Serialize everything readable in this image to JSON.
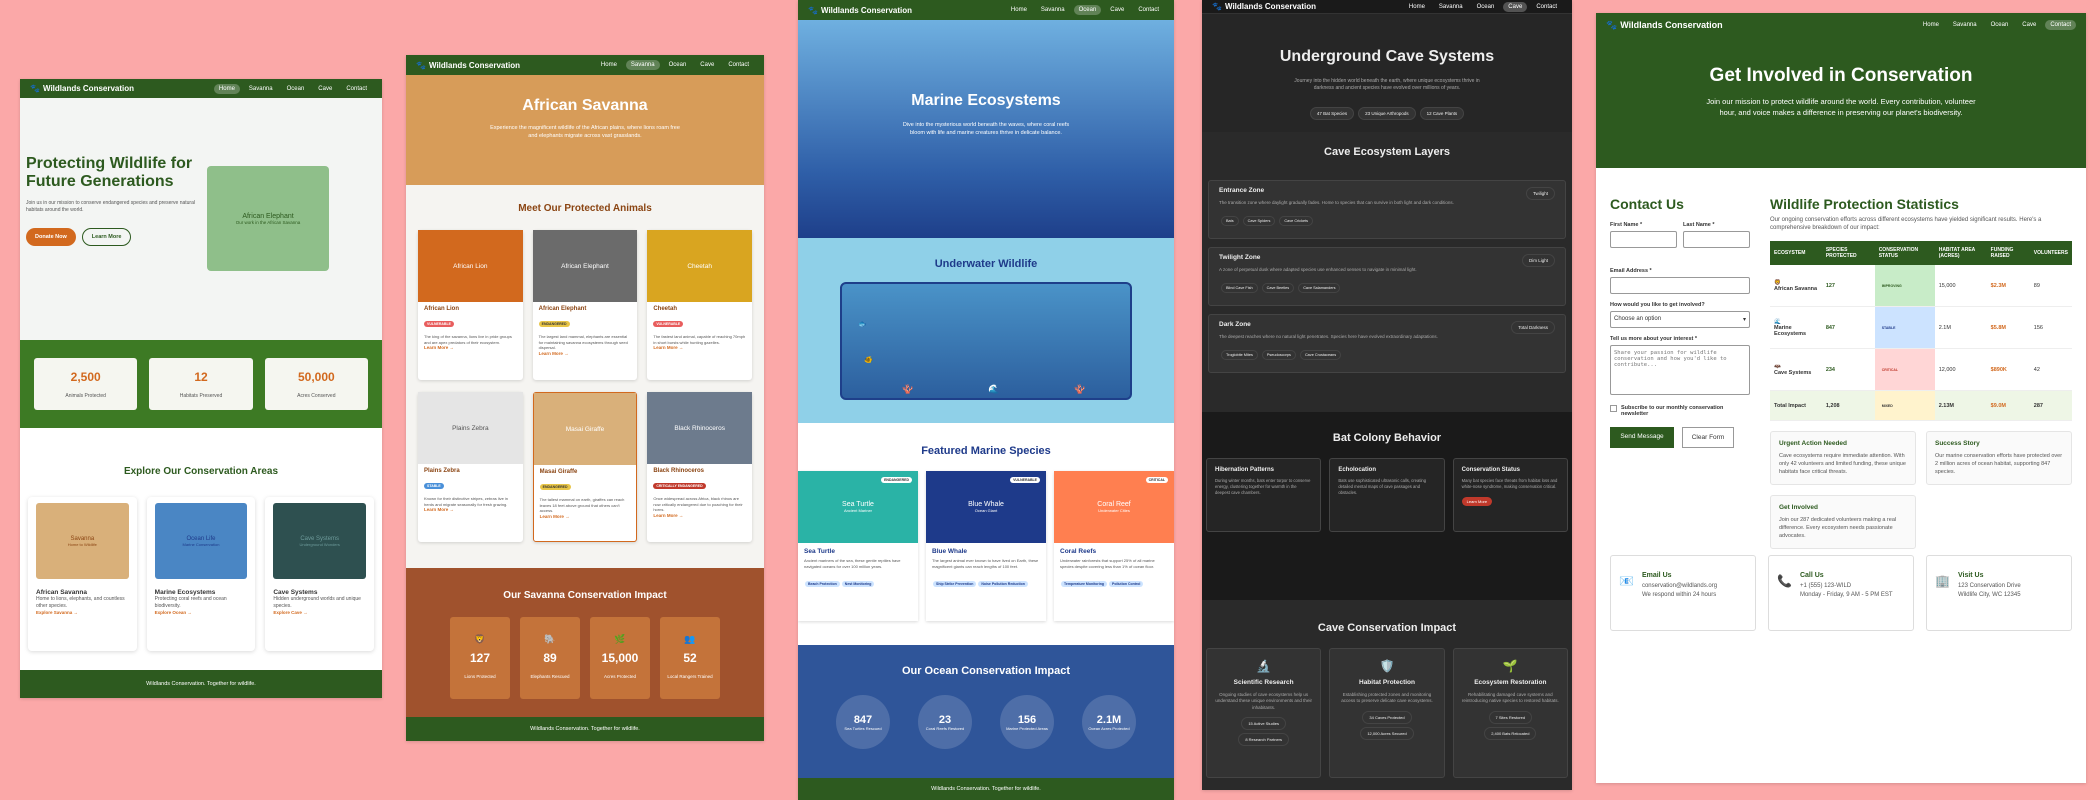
{
  "brand": "Wildlands Conservation",
  "brand_icon": "paw-icon",
  "nav": [
    "Home",
    "Savanna",
    "Ocean",
    "Cave",
    "Contact"
  ],
  "footer": "Wildlands Conservation. Together for wildlife.",
  "home": {
    "title": "Protecting Wildlife for Future Generations",
    "text": "Join us in our mission to conserve endangered species and preserve natural habitats around the world.",
    "donate": "Donate Now",
    "learn": "Learn More",
    "hero_img": "African Elephant",
    "hero_img_sub": "Our work in the African Savanna",
    "stats": [
      {
        "value": "2,500",
        "label": "Animals Protected"
      },
      {
        "value": "12",
        "label": "Habitats Preserved"
      },
      {
        "value": "50,000",
        "label": "Acres Conserved"
      }
    ],
    "explore_title": "Explore Our Conservation Areas",
    "areas": [
      {
        "img": "Savanna",
        "img_sub": "Home to Wildlife",
        "title": "African Savanna",
        "text": "Home to lions, elephants, and countless other species.",
        "link": "Explore Savanna →",
        "color": "#d9b07a"
      },
      {
        "img": "Ocean Life",
        "img_sub": "Marine Conservation",
        "title": "Marine Ecosystems",
        "text": "Protecting coral reefs and ocean biodiversity.",
        "link": "Explore Ocean →",
        "color": "#4a86c4"
      },
      {
        "img": "Cave Systems",
        "img_sub": "Underground Wonders",
        "title": "Cave Systems",
        "text": "Hidden underground worlds and unique species.",
        "link": "Explore Cave →",
        "color": "#2e5050"
      }
    ]
  },
  "savanna": {
    "title": "African Savanna",
    "text": "Experience the magnificent wildlife of the African plains, where lions roam free and elephants migrate across vast grasslands.",
    "animals_title": "Meet Our Protected Animals",
    "animals": [
      {
        "name": "African Lion",
        "status": "VULNERABLE",
        "text": "The king of the savanna, lions live in pride groups and are apex predators of their ecosystem.",
        "color": "#d2691e",
        "tag": "#e85d5d"
      },
      {
        "name": "African Elephant",
        "status": "ENDANGERED",
        "text": "The largest land mammal, elephants are essential for maintaining savanna ecosystems through seed dispersal.",
        "color": "#6b6b6b",
        "tag": "#e8c547"
      },
      {
        "name": "Cheetah",
        "status": "VULNERABLE",
        "text": "The fastest land animal, capable of reaching 70mph in short bursts while hunting gazelles.",
        "color": "#d9a520",
        "tag": "#e85d5d"
      },
      {
        "name": "Plains Zebra",
        "status": "STABLE",
        "text": "Known for their distinctive stripes, zebras live in herds and migrate seasonally for fresh grazing.",
        "color": "#e5e5e5",
        "tag": "#4a90d9"
      },
      {
        "name": "Masai Giraffe",
        "status": "ENDANGERED",
        "text": "The tallest mammal on earth, giraffes can reach leaves 18 feet above ground that others can't access.",
        "color": "#d9b07a",
        "tag": "#e8c547"
      },
      {
        "name": "Black Rhinoceros",
        "status": "CRITICALLY ENDANGERED",
        "text": "Once widespread across Africa, black rhinos are now critically endangered due to poaching for their horns.",
        "color": "#6d7b8d",
        "tag": "#c0392b"
      }
    ],
    "learn": "Learn More →",
    "impact_title": "Our Savanna Conservation Impact",
    "impact": [
      {
        "icon": "lion-icon",
        "value": "127",
        "label": "Lions Protected"
      },
      {
        "icon": "elephant-icon",
        "value": "89",
        "label": "Elephants Rescued"
      },
      {
        "icon": "plant-icon",
        "value": "15,000",
        "label": "Acres Protected"
      },
      {
        "icon": "people-icon",
        "value": "52",
        "label": "Local Rangers Trained"
      }
    ]
  },
  "ocean": {
    "title": "Marine Ecosystems",
    "text": "Dive into the mysterious world beneath the waves, where coral reefs bloom with life and marine creatures thrive in delicate balance.",
    "wild_title": "Underwater Wildlife",
    "species_title": "Featured Marine Species",
    "species": [
      {
        "name": "Sea Turtle",
        "sub": "Ancient Mariner",
        "status": "ENDANGERED",
        "title": "Sea Turtle",
        "text": "Ancient mariners of the sea, these gentle reptiles have navigated oceans for over 100 million years.",
        "tags": [
          "Beach Protection",
          "Nest Monitoring"
        ],
        "color": "#2ab3a6"
      },
      {
        "name": "Blue Whale",
        "sub": "Ocean Giant",
        "status": "VULNERABLE",
        "title": "Blue Whale",
        "text": "The largest animal ever known to have lived on Earth, these magnificent giants can reach lengths of 100 feet.",
        "tags": [
          "Ship Strike Prevention",
          "Noise Pollution Reduction"
        ],
        "color": "#1e3a8a"
      },
      {
        "name": "Coral Reef",
        "sub": "Underwater Cities",
        "status": "CRITICAL",
        "title": "Coral Reefs",
        "text": "Underwater rainforests that support 25% of all marine species despite covering less than 1% of ocean floor.",
        "tags": [
          "Temperature Monitoring",
          "Pollution Control"
        ],
        "color": "#ff7f50"
      }
    ],
    "impact_title": "Our Ocean Conservation Impact",
    "impact": [
      {
        "value": "847",
        "label": "Sea Turtles Rescued"
      },
      {
        "value": "23",
        "label": "Coral Reefs Restored"
      },
      {
        "value": "156",
        "label": "Marine Protected Areas"
      },
      {
        "value": "2.1M",
        "label": "Ocean Acres Protected"
      }
    ]
  },
  "cave": {
    "title": "Underground Cave Systems",
    "text": "Journey into the hidden world beneath the earth, where unique ecosystems thrive in darkness and ancient species have evolved over millions of years.",
    "chips": [
      "47 Bat Species",
      "23 Unique Arthropods",
      "12 Cave Plants"
    ],
    "layers_title": "Cave Ecosystem Layers",
    "layers": [
      {
        "title": "Entrance Zone",
        "badge": "Twilight",
        "text": "The transition zone where daylight gradually fades. Home to species that can survive in both light and dark conditions.",
        "chips": [
          "Bats",
          "Cave Spiders",
          "Cave Crickets"
        ]
      },
      {
        "title": "Twilight Zone",
        "badge": "Dim Light",
        "text": "A zone of perpetual dusk where adapted species use enhanced senses to navigate in minimal light.",
        "chips": [
          "Blind Cave Fish",
          "Cave Beetles",
          "Cave Salamanders"
        ]
      },
      {
        "title": "Dark Zone",
        "badge": "Total Darkness",
        "text": "The deepest reaches where no natural light penetrates. Species here have evolved extraordinary adaptations.",
        "chips": [
          "Troglobite Mites",
          "Pseudoscorps",
          "Cave Crustaceans"
        ]
      }
    ],
    "bats_title": "Bat Colony Behavior",
    "bats": [
      {
        "title": "Hibernation Patterns",
        "text": "During winter months, bats enter torpor to conserve energy, clustering together for warmth in the deepest cave chambers."
      },
      {
        "title": "Echolocation",
        "text": "Bats use sophisticated ultrasonic calls, creating detailed mental maps of cave passages and obstacles."
      },
      {
        "title": "Conservation Status",
        "text": "Many bat species face threats from habitat loss and white-nose syndrome, making conservation critical.",
        "btn": "Learn More"
      }
    ],
    "impact_title": "Cave Conservation Impact",
    "impact": [
      {
        "icon": "microscope-icon",
        "title": "Scientific Research",
        "text": "Ongoing studies of cave ecosystems help us understand these unique environments and their inhabitants.",
        "pills": [
          "15 Active Studies",
          "8 Research Partners"
        ]
      },
      {
        "icon": "shield-icon",
        "title": "Habitat Protection",
        "text": "Establishing protected zones and monitoring access to preserve delicate cave ecosystems.",
        "pills": [
          "34 Caves Protected",
          "12,000 Acres Secured"
        ]
      },
      {
        "icon": "sprout-icon",
        "title": "Ecosystem Restoration",
        "text": "Rehabilitating damaged cave systems and reintroducing native species to restored habitats.",
        "pills": [
          "7 Sites Restored",
          "2,400 Bats Relocated"
        ]
      }
    ]
  },
  "contact": {
    "title": "Get Involved in Conservation",
    "text": "Join our mission to protect wildlife around the world. Every contribution, volunteer hour, and voice makes a difference in preserving our planet's biodiversity.",
    "form_title": "Contact Us",
    "first": "First Name *",
    "last": "Last Name *",
    "email": "Email Address *",
    "involve": "How would you like to get involved?",
    "involve_value": "Choose an option",
    "interest": "Tell us more about your interest *",
    "interest_ph": "Share your passion for wildlife conservation and how you'd like to contribute...",
    "newsletter": "Subscribe to our monthly conservation newsletter",
    "send": "Send Message",
    "clear": "Clear Form",
    "stats_title": "Wildlife Protection Statistics",
    "stats_text": "Our ongoing conservation efforts across different ecosystems have yielded significant results. Here's a comprehensive breakdown of our impact:",
    "headers": [
      "ECOSYSTEM",
      "SPECIES PROTECTED",
      "CONSERVATION STATUS",
      "HABITAT AREA (ACRES)",
      "FUNDING RAISED",
      "VOLUNTEERS"
    ],
    "rows": [
      {
        "eco": "African Savanna",
        "icon": "lion-icon",
        "species": "127",
        "status": "IMPROVING",
        "status_bg": "#c8ecc8",
        "status_fg": "#2d5a1f",
        "area": "15,000",
        "funding": "$2.3M",
        "vol": "89"
      },
      {
        "eco": "Marine Ecosystems",
        "icon": "wave-icon",
        "species": "847",
        "status": "STABLE",
        "status_bg": "#cce3ff",
        "status_fg": "#1e3a8a",
        "area": "2.1M",
        "funding": "$5.8M",
        "vol": "156"
      },
      {
        "eco": "Cave Systems",
        "icon": "bat-icon",
        "species": "234",
        "status": "CRITICAL",
        "status_bg": "#ffd6d6",
        "status_fg": "#c0392b",
        "area": "12,000",
        "funding": "$890K",
        "vol": "42"
      }
    ],
    "total": {
      "eco": "Total Impact",
      "species": "1,208",
      "status": "MIXED",
      "area": "2.13M",
      "funding": "$9.0M",
      "vol": "287"
    },
    "cards": [
      {
        "title": "Urgent Action Needed",
        "text": "Cave ecosystems require immediate attention. With only 42 volunteers and limited funding, these unique habitats face critical threats."
      },
      {
        "title": "Success Story",
        "text": "Our marine conservation efforts have protected over 2 million acres of ocean habitat, supporting 847 species."
      },
      {
        "title": "Get Involved",
        "text": "Join our 287 dedicated volunteers making a real difference. Every ecosystem needs passionate advocates."
      }
    ],
    "info": [
      {
        "icon": "mail-icon",
        "title": "Email Us",
        "l1": "conservation@wildlands.org",
        "l2": "We respond within 24 hours"
      },
      {
        "icon": "phone-icon",
        "title": "Call Us",
        "l1": "+1 (555) 123-WILD",
        "l2": "Monday - Friday, 9 AM - 5 PM EST"
      },
      {
        "icon": "building-icon",
        "title": "Visit Us",
        "l1": "123 Conservation Drive",
        "l2": "Wildlife City, WC 12345"
      }
    ]
  }
}
